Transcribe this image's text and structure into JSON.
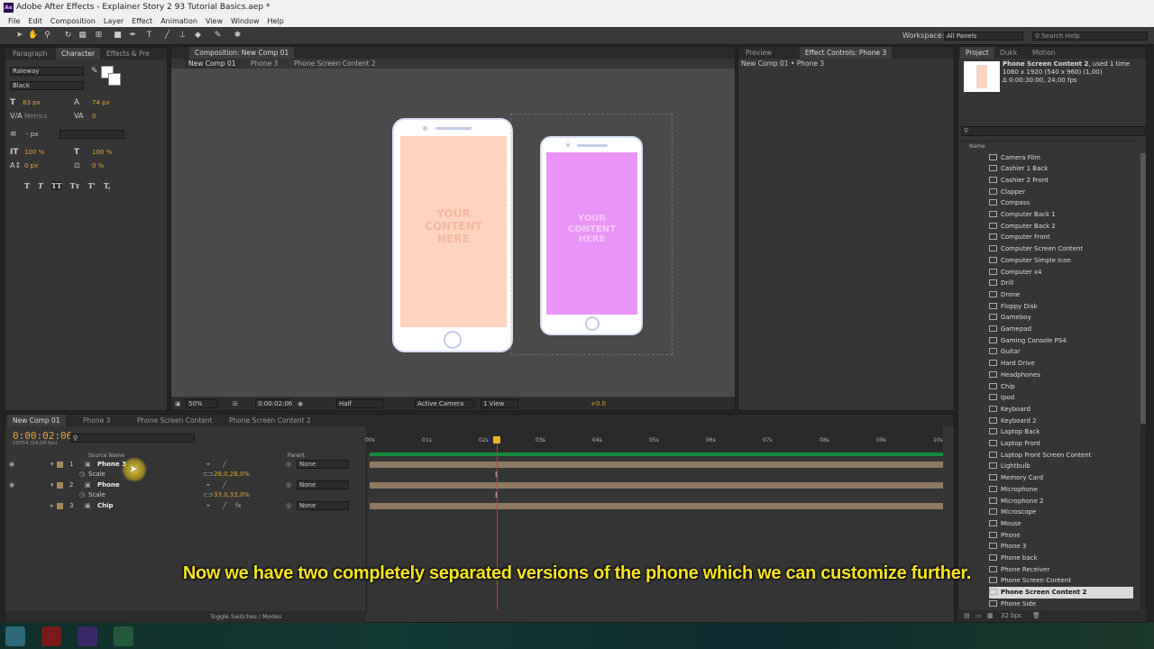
{
  "window": {
    "title": "Adobe After Effects - Explainer Story 2 93 Tutorial Basics.aep *",
    "app_icon": "Ae"
  },
  "menu": [
    "File",
    "Edit",
    "Composition",
    "Layer",
    "Effect",
    "Animation",
    "View",
    "Window",
    "Help"
  ],
  "toolbar": {
    "workspace_label": "Workspace:",
    "workspace_value": "All Panels",
    "search_placeholder": "Search Help"
  },
  "left_panel": {
    "tabs": [
      "Paragraph",
      "Character",
      "Effects & Pre"
    ],
    "font": "Raleway",
    "style": "Black",
    "size": "83 px",
    "leading": "74 px",
    "kerning": "Metrics",
    "tracking": "0",
    "stroke_unit": "- px",
    "vscale": "100 %",
    "hscale": "100 %",
    "baseline": "0 px",
    "tsume": "0 %",
    "style_buttons": [
      "T",
      "T",
      "TT",
      "Tт",
      "T'",
      "T,"
    ]
  },
  "composition": {
    "tab": "Composition: New Comp 01",
    "breadcrumbs": [
      "New Comp 01",
      "Phone 3",
      "Phone Screen Content 2"
    ],
    "phone_text": "YOUR\nCONTENT\nHERE",
    "phone1_color": "#ffd3bd",
    "phone2_color": "#e995f7",
    "footer": {
      "zoom": "50%",
      "timecode": "0:00:02:06",
      "resolution": "Half",
      "camera": "Active Camera",
      "views": "1 View",
      "exposure": "+0.0"
    }
  },
  "effect_panel": {
    "tabs": [
      "Preview",
      "Effect Controls: Phone 3"
    ],
    "breadcrumb": "New Comp 01 • Phone 3"
  },
  "project": {
    "tabs": [
      "Project",
      "Dukk",
      "Motion"
    ],
    "info_name": "Phone Screen Content 2",
    "info_used": ", used 1 time",
    "info_dims": "1080 x 1920  (540 x 960) (1,00)",
    "info_dur": "Δ 0:00:30:00, 24,00 fps",
    "column": "Name",
    "items": [
      "Camera Film",
      "Cashier 1 Back",
      "Cashier 2 Front",
      "Clapper",
      "Compass",
      "Computer Back 1",
      "Computer Back 2",
      "Computer Front",
      "Computer Screen Content",
      "Computer Simple Icon",
      "Computer x4",
      "Drill",
      "Drone",
      "Floppy Disk",
      "Gameboy",
      "Gamepad",
      "Gaming Console PS4",
      "Guitar",
      "Hard Drive",
      "Headphones",
      "Chip",
      "Ipod",
      "Keyboard",
      "Keyboard 2",
      "Laptop Back",
      "Laptop Front",
      "Laptop Front Screen Content",
      "Lightbulb",
      "Memory Card",
      "Microphone",
      "Microphone 2",
      "Microscope",
      "Mouse",
      "Phone",
      "Phone 3",
      "Phone back",
      "Phone Receiver",
      "Phone Screen Content",
      "Phone Screen Content 2",
      "Phone Side"
    ],
    "selected": "Phone Screen Content 2",
    "bpc": "32 bpc"
  },
  "timeline": {
    "tabs": [
      "New Comp 01",
      "Phone 3",
      "Phone Screen Content",
      "Phone Screen Content 2"
    ],
    "timecode": "0:00:02:06",
    "frames": "00054 (24.00 fps)",
    "col_source": "Source Name",
    "col_parent": "Parent",
    "ruler": [
      "00s",
      "01s",
      "02s",
      "03s",
      "04s",
      "05s",
      "06s",
      "07s",
      "08s",
      "09s",
      "10s"
    ],
    "playhead_fraction": 0.222,
    "layers": [
      {
        "num": "1",
        "name": "Phone 3",
        "parent": "None",
        "prop": "Scale",
        "value": "28,0,28,0%"
      },
      {
        "num": "2",
        "name": "Phone",
        "parent": "None",
        "prop": "Scale",
        "value": "33,0,33,0%"
      },
      {
        "num": "3",
        "name": "Chip",
        "parent": "None"
      }
    ],
    "toggle": "Toggle Switches / Modes"
  },
  "caption": "Now we have two completely separated versions of the phone which we can customize further."
}
